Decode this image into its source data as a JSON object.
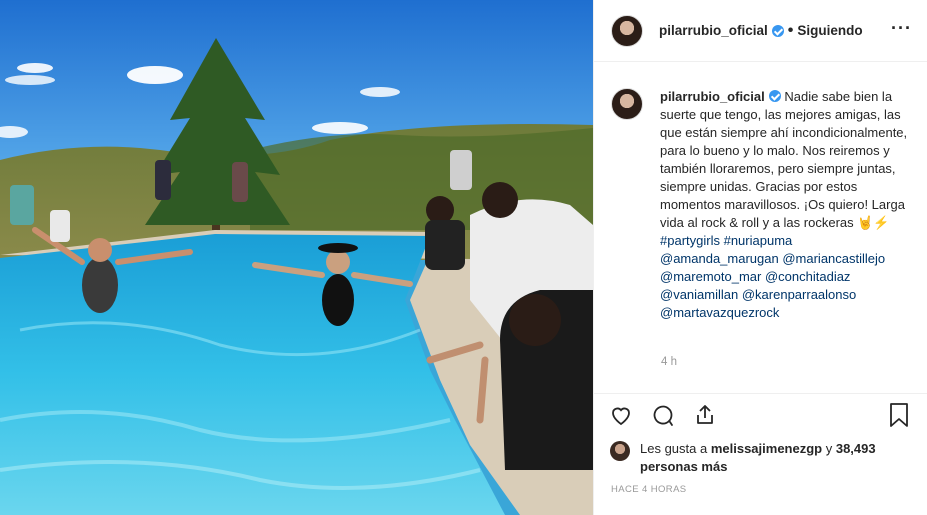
{
  "post": {
    "username": "pilarrubio_oficial",
    "separator": "•",
    "follow_label": "Siguiendo",
    "more_label": "···",
    "caption": {
      "username": "pilarrubio_oficial",
      "text_1": " Nadie sabe bien la suerte que tengo, las mejores amigas, las que están siempre ahí incondicionalmente, para lo bueno y lo malo. Nos reiremos y también lloraremos, pero siempre juntas, siempre unidas. Gracias por estos momentos maravillosos. ¡Os quiero! Larga vida al rock & roll y a las rockeras ",
      "emojis": "🤘⚡",
      "hashtags": [
        "#partygirls",
        "#nuriapuma"
      ],
      "mentions": [
        "@amanda_marugan",
        "@mariancastillejo",
        "@maremoto_mar",
        "@conchitadiaz",
        "@vaniamillan",
        "@karenparraalonso",
        "@martavazquezrock"
      ]
    },
    "time_ago": "4 h",
    "likes_prefix": "Les gusta a ",
    "likes_user": "melissajimenezgp",
    "likes_mid": " y ",
    "likes_count": "38,493 personas más",
    "posted": "HACE 4 HORAS"
  },
  "icons": {
    "like": "heart-icon",
    "comment": "comment-icon",
    "share": "share-icon",
    "save": "bookmark-icon",
    "verified": "verified-badge-icon"
  },
  "colors": {
    "verified": "#3897f0",
    "link": "#003569",
    "muted": "#999999",
    "border": "#efefef"
  }
}
